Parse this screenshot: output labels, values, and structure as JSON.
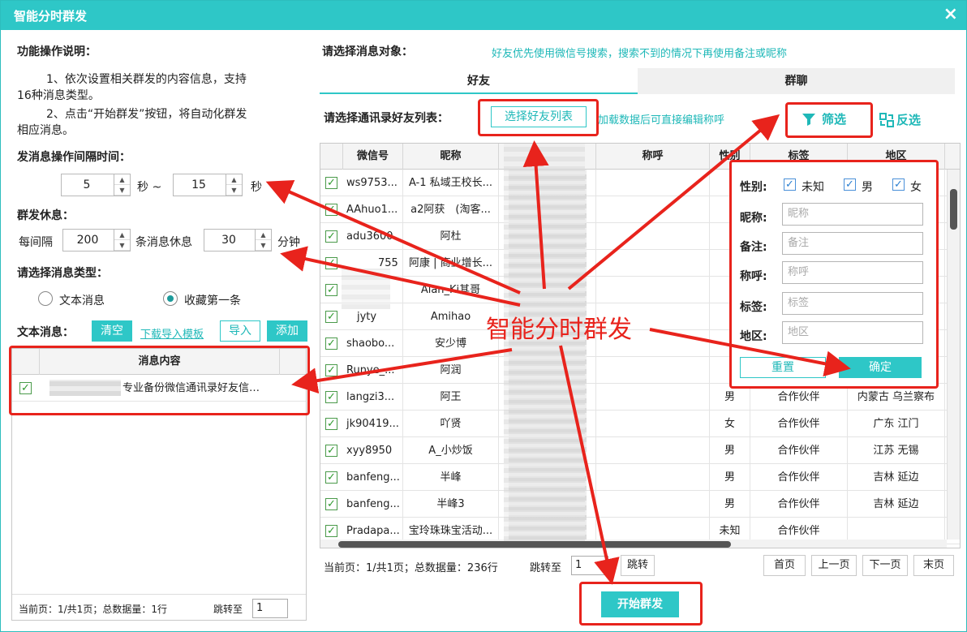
{
  "window": {
    "title": "智能分时群发",
    "close_glyph": "×"
  },
  "left": {
    "instructions_title": "功能操作说明：",
    "instruction_1a": "1、依次设置相关群发的内容信息，支持",
    "instruction_1b": "16种消息类型。",
    "instruction_2a": "2、点击“开始群发”按钮，将自动化群发",
    "instruction_2b": "相应消息。",
    "interval_title": "发消息操作间隔时间：",
    "interval_min": "5",
    "interval_sep": "秒 ~",
    "interval_max": "15",
    "interval_unit": "秒",
    "rest_title": "群发休息：",
    "rest_prefix": "每间隔",
    "rest_count": "200",
    "rest_mid": "条消息休息",
    "rest_minutes": "30",
    "rest_unit": "分钟",
    "type_title": "请选择消息类型：",
    "type_text": "文本消息",
    "type_fav": "收藏第一条",
    "text_msg_title": "文本消息：",
    "clear_label": "清空",
    "download_template": "下载导入模板",
    "import_label": "导入",
    "add_label": "添加",
    "msg_col_header": "消息内容",
    "msg_row_text": "专业备份微信通讯录好友信…",
    "footer_page": "当前页：1/共1页；总数据量：1行",
    "footer_jump": "跳转至",
    "footer_jump_value": "1"
  },
  "right": {
    "target_title": "请选择消息对象：",
    "target_hint": "好友优先使用微信号搜索，搜索不到的情况下再使用备注或昵称",
    "tab_friends": "好友",
    "tab_groups": "群聊",
    "contacts_label": "请选择通讯录好友列表：",
    "select_friends_btn": "选择好友列表",
    "edit_hint": "加载数据后可直接编辑称呼",
    "filter_label": "筛选",
    "invert_label": "反选",
    "columns": {
      "wxid": "微信号",
      "nickname": "昵称",
      "title": "称呼",
      "gender": "性别",
      "tag": "标签",
      "region": "地区"
    },
    "rows": [
      {
        "wxid": "ws9753...",
        "nickname": "A-1 私域王校长...",
        "gender": "",
        "tag": "",
        "region": ""
      },
      {
        "wxid": "AAhuo1...",
        "nickname": "a2阿获　(淘客...",
        "gender": "",
        "tag": "",
        "region": ""
      },
      {
        "wxid": "adu3600",
        "nickname": "阿杜",
        "gender": "",
        "tag": "",
        "region": ""
      },
      {
        "wxid": "　　　755",
        "nickname": "阿康 | 商业增长...",
        "gender": "",
        "tag": "",
        "region": ""
      },
      {
        "wxid": "",
        "nickname": "Alan_Ki其哥",
        "gender": "",
        "tag": "",
        "region": ""
      },
      {
        "wxid": "　jyty",
        "nickname": "Amihao",
        "gender": "",
        "tag": "",
        "region": ""
      },
      {
        "wxid": "shaobo...",
        "nickname": "安少博",
        "gender": "",
        "tag": "",
        "region": ""
      },
      {
        "wxid": "Runye_...",
        "nickname": "阿润",
        "gender": "",
        "tag": "",
        "region": ""
      },
      {
        "wxid": "langzi3...",
        "nickname": "阿王",
        "gender": "男",
        "tag": "合作伙伴",
        "region": "内蒙古 乌兰察布"
      },
      {
        "wxid": "jk90419...",
        "nickname": "吖贤",
        "gender": "女",
        "tag": "合作伙伴",
        "region": "广东 江门"
      },
      {
        "wxid": "xyy8950",
        "nickname": "A_小炒饭",
        "gender": "男",
        "tag": "合作伙伴",
        "region": "江苏 无锡"
      },
      {
        "wxid": "banfeng...",
        "nickname": "半峰",
        "gender": "男",
        "tag": "合作伙伴",
        "region": "吉林 延边"
      },
      {
        "wxid": "banfeng...",
        "nickname": "半峰3",
        "gender": "男",
        "tag": "合作伙伴",
        "region": "吉林 延边"
      },
      {
        "wxid": "Pradapa...",
        "nickname": "宝玲珠珠宝活动...",
        "gender": "未知",
        "tag": "合作伙伴",
        "region": ""
      }
    ],
    "footer_page": "当前页：1/共1页；总数据量：236行",
    "footer_jump": "跳转至",
    "footer_jump_value": "1",
    "footer_go": "跳转",
    "first_page": "首页",
    "prev_page": "上一页",
    "next_page": "下一页",
    "last_page": "末页",
    "start_btn": "开始群发"
  },
  "filter_popup": {
    "gender_label": "性别:",
    "gender_unknown": "未知",
    "gender_male": "男",
    "gender_female": "女",
    "nickname_label": "昵称:",
    "nickname_ph": "昵称",
    "remark_label": "备注:",
    "remark_ph": "备注",
    "title_label": "称呼:",
    "title_ph": "称呼",
    "tag_label": "标签:",
    "tag_ph": "标签",
    "region_label": "地区:",
    "region_ph": "地区",
    "reset_btn": "重置",
    "confirm_btn": "确定"
  },
  "annotation": {
    "center_text": "智能分时群发"
  },
  "colors": {
    "accent": "#2ec7c7",
    "annotation_red": "#e8231c"
  }
}
